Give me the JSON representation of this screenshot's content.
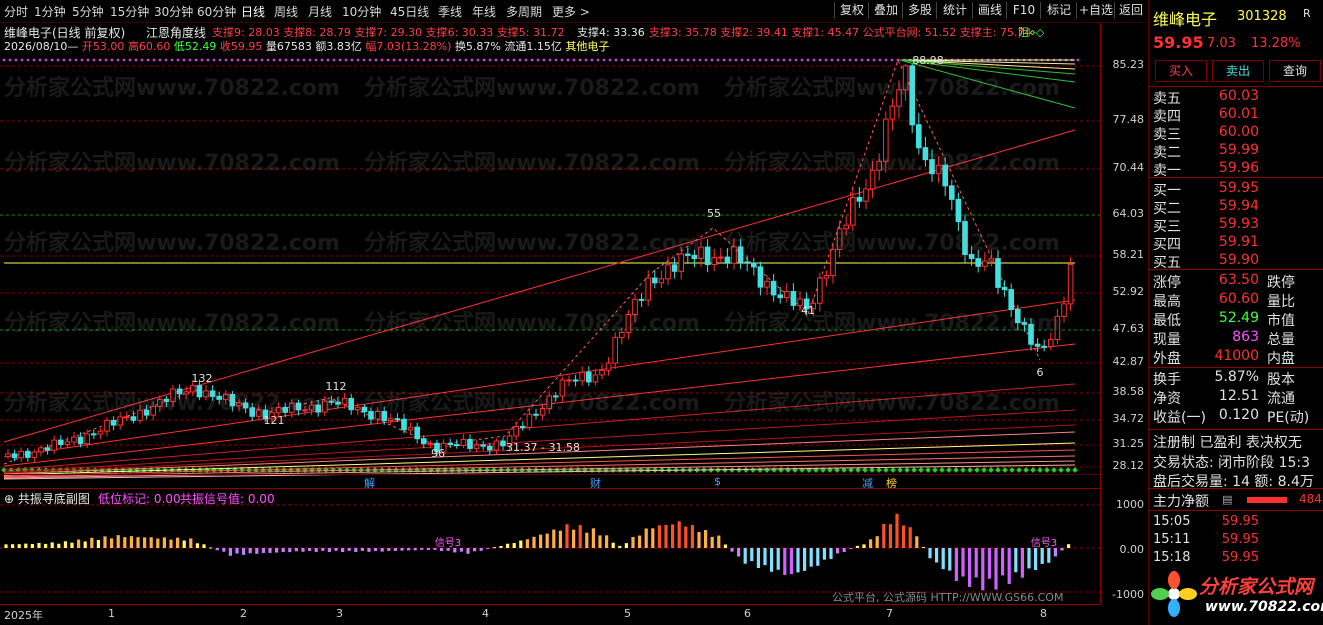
{
  "toolbar": {
    "periods": [
      "分时",
      "1分钟",
      "5分钟",
      "15分钟",
      "30分钟",
      "60分钟",
      "日线",
      "周线",
      "月线",
      "10分钟",
      "45日线",
      "季线",
      "年线",
      "多周期",
      "更多 >"
    ],
    "active_period": "日线",
    "right_buttons": [
      "复权",
      "叠加",
      "多股",
      "统计",
      "画线",
      "F10",
      "标记",
      "+自选",
      "返回"
    ]
  },
  "header": {
    "stock_title": "维峰电子(日线 前复权)",
    "indicator_name": "江恩角度线",
    "supports": "支撑9: 28.03  支撑8: 28.79  支撑7: 29.30  支撑6: 30.33  支撑5: 31.72",
    "support4": "支撑4: 33.36",
    "supports2": "支撑3: 35.78  支撑2: 39.41  支撑1: 45.47  公式平台网: 51.52  支撑主: 75.74",
    "resist_hint": "阻⋄◇",
    "date": "2026/08/10",
    "open": "开53.00",
    "high": "高60.60",
    "low": "低52.49",
    "close": "收59.95",
    "volume": "量67583",
    "amount": "额3.83亿",
    "change": "幅7.03(13.28%)",
    "turnover": "换5.87%",
    "float": "流通1.15亿",
    "sector": "其他电子"
  },
  "main_chart": {
    "price_labels": [
      "85.23",
      "77.48",
      "70.44",
      "64.03",
      "58.21",
      "52.92",
      "47.63",
      "42.87",
      "38.58",
      "34.72",
      "31.25",
      "28.12"
    ],
    "annotations": [
      "132",
      "121",
      "112",
      "96",
      "31.37 - 31.58",
      "55",
      "41",
      "6",
      "88.98"
    ],
    "event_markers": [
      "解",
      "财",
      "$",
      "减",
      "榜"
    ],
    "watermark": "分析家公式网www.70822.com"
  },
  "sub_chart": {
    "title": "共振寻底副图",
    "low_mark": "低位标记: 0.00",
    "resonance": "共振信号值: 0.00",
    "signal_labels": [
      "信号3",
      "信号3"
    ],
    "y_labels": [
      "1000",
      "0.00",
      "-1000"
    ],
    "footer_watermark": "公式平台, 公式源码 HTTP://WWW.GS66.COM"
  },
  "x_axis": {
    "labels": [
      "2025年",
      "1",
      "2",
      "3",
      "4",
      "5",
      "6",
      "7",
      "8"
    ]
  },
  "right_panel": {
    "name": "维峰电子",
    "code": "301328",
    "tag": "R",
    "price": "59.95",
    "change": "7.03",
    "pct": "13.28%",
    "buttons": [
      "买入",
      "卖出",
      "查询"
    ],
    "asks": [
      {
        "label": "卖五",
        "price": "60.03"
      },
      {
        "label": "卖四",
        "price": "60.01"
      },
      {
        "label": "卖三",
        "price": "60.00"
      },
      {
        "label": "卖二",
        "price": "59.99"
      },
      {
        "label": "卖一",
        "price": "59.96"
      }
    ],
    "bids": [
      {
        "label": "买一",
        "price": "59.95"
      },
      {
        "label": "买二",
        "price": "59.94"
      },
      {
        "label": "买三",
        "price": "59.93"
      },
      {
        "label": "买四",
        "price": "59.91"
      },
      {
        "label": "买五",
        "price": "59.90"
      }
    ],
    "stats1": [
      {
        "label": "涨停",
        "value": "63.50",
        "label2": "跌停"
      },
      {
        "label": "最高",
        "value": "60.60",
        "label2": "量比"
      },
      {
        "label": "最低",
        "value": "52.49",
        "label2": "市值"
      },
      {
        "label": "现量",
        "value": "863",
        "label2": "总量"
      },
      {
        "label": "外盘",
        "value": "41000",
        "label2": "内盘"
      }
    ],
    "stats2": [
      {
        "label": "换手",
        "value": "5.87%",
        "label2": "股本"
      },
      {
        "label": "净资",
        "value": "12.51",
        "label2": "流通"
      },
      {
        "label": "收益(一)",
        "value": "0.120",
        "label2": "PE(动)"
      }
    ],
    "reg_line": "注册制 已盈利 表决权无",
    "trade_status": "交易状态: 闭市阶段 15:3",
    "after_trade": "盘后交易量: 14  额: 8.4万",
    "main_net": "主力净额",
    "main_net_value": "484",
    "ticks": [
      {
        "time": "15:05",
        "price": "59.95"
      },
      {
        "time": "15:11",
        "price": "59.95"
      },
      {
        "time": "15:18",
        "price": "59.95"
      }
    ],
    "logo_text": "分析家公式网",
    "logo_url": "www.70822.com"
  },
  "colors": {
    "up": "#ff3030",
    "down": "#40e0e0",
    "grid": "#8a0000",
    "ma_yellow": "#ffff50"
  }
}
